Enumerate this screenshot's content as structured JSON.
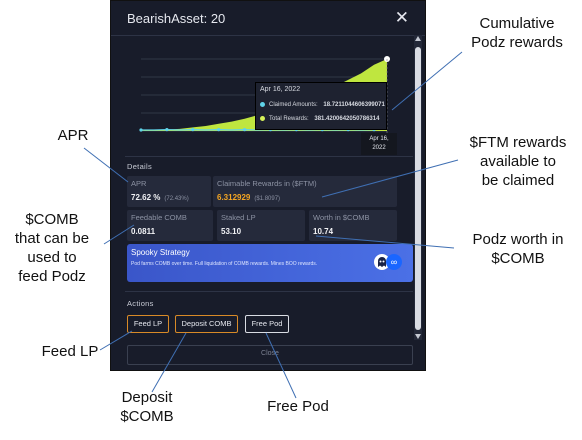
{
  "modal": {
    "title": "BearishAsset: 20",
    "close_icon": "✕",
    "tooltip": {
      "date": "Apr 16, 2022",
      "claimed_label": "Claimed Amounts:",
      "claimed_value": "18.7211044606399071",
      "total_label": "Total Rewards:",
      "total_value": "381.4200642050786314",
      "claimed_color": "#5fd3e8",
      "total_color": "#d6f25a"
    },
    "x_tooltip": {
      "line1": "Apr 16,",
      "line2": "2022"
    },
    "details_label": "Details",
    "apr": {
      "label": "APR",
      "value": "72.62 %",
      "sub": "(72.43%)"
    },
    "claimable": {
      "label": "Claimable Rewards in ($FTM)",
      "value": "6.312929",
      "sub": "($1.8097)"
    },
    "feedable": {
      "label": "Feedable COMB",
      "value": "0.0811"
    },
    "staked": {
      "label": "Staked LP",
      "value": "53.10"
    },
    "worth": {
      "label": "Worth in $COMB",
      "value": "10.74"
    },
    "strategy": {
      "title": "Spooky Strategy",
      "description": "Pod farms COMB over time. Full liquidation of COMB rewards. Mines BOO rewards.",
      "icon_text": "∞"
    },
    "actions_label": "Actions",
    "buttons": {
      "feed_lp": "Feed LP",
      "deposit_comb": "Deposit COMB",
      "free_pod": "Free Pod"
    },
    "close_label": "Close"
  },
  "annotations": {
    "cumulative": "Cumulative\nPodz rewards",
    "apr": "APR",
    "ftm": "$FTM rewards\navailable to\nbe claimed",
    "comb_feed": "$COMB\nthat can be\nused to\nfeed Podz",
    "podz_worth": "Podz worth in\n$COMB",
    "feed_lp": "Feed LP",
    "deposit": "Deposit\n$COMB",
    "free_pod": "Free Pod"
  },
  "colors": {
    "area": "#bfe63f",
    "line": "#d6f25a",
    "claimed_dot": "#5fd3e8",
    "orange": "#d88a27",
    "value_orange": "#f5a623"
  },
  "chart_data": {
    "type": "area",
    "series": [
      {
        "name": "Total Rewards",
        "values": [
          0.5,
          1,
          2,
          3,
          5,
          7,
          10,
          13,
          17,
          22,
          28,
          34,
          40,
          47,
          54,
          62,
          71,
          80,
          92,
          100
        ]
      },
      {
        "name": "Claimed Amounts",
        "values": [
          0,
          0,
          0.5,
          0,
          0.5,
          0,
          0.5,
          0,
          0.5,
          0,
          0.5,
          0,
          0.5,
          0,
          0.5,
          0,
          0.5,
          0,
          0.5,
          5
        ]
      }
    ],
    "ylim": [
      0,
      100
    ],
    "grid": true
  }
}
